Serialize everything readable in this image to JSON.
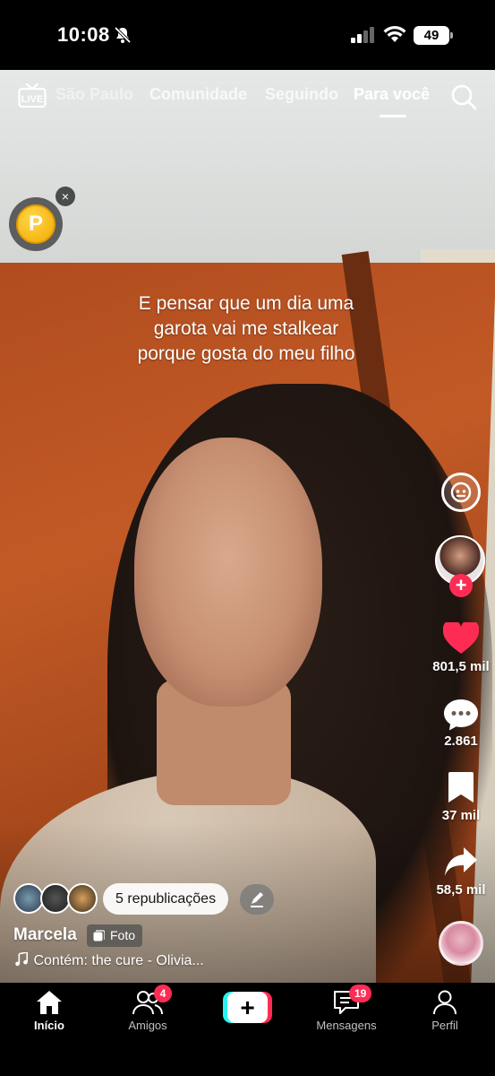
{
  "status_bar": {
    "time": "10:08",
    "battery": "49",
    "icons": [
      "bell-off-icon",
      "signal-icon",
      "wifi-icon",
      "battery-icon"
    ]
  },
  "top_nav": {
    "tabs": [
      {
        "label": "São Paulo"
      },
      {
        "label": "Comunidade"
      },
      {
        "label": "Seguindo"
      },
      {
        "label": "Para você",
        "active": true
      }
    ],
    "live_label": "LIVE"
  },
  "coin_widget": {
    "coin_letter": "P",
    "close_label": "×"
  },
  "caption": {
    "line1": "E pensar que um dia uma",
    "line2": "garota vai me stalkear",
    "line3": "porque gosta do meu filho"
  },
  "actions": {
    "likes": "801,5 mil",
    "comments": "2.861",
    "saves": "37 mil",
    "shares": "58,5 mil",
    "follow_label": "+"
  },
  "post": {
    "reposts_label": "5 republicações",
    "username": "Marcela",
    "type_badge": "Foto",
    "music": "Contém: the cure - Olivia..."
  },
  "tab_bar": {
    "home": "Início",
    "friends": "Amigos",
    "friends_badge": "4",
    "create": "+",
    "messages": "Mensagens",
    "messages_badge": "19",
    "profile": "Perfil"
  },
  "colors": {
    "accent_red": "#fe2c55",
    "accent_cyan": "#25f4ee",
    "like_red": "#fe2c55"
  }
}
